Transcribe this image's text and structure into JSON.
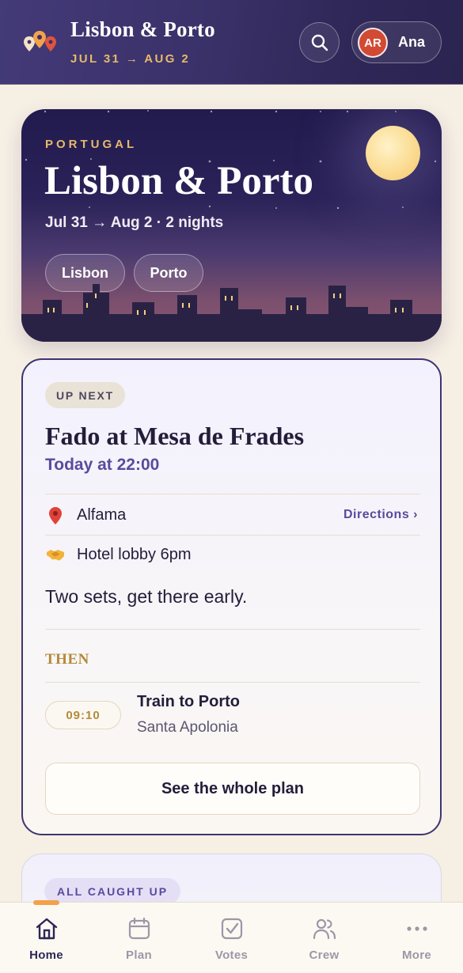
{
  "header": {
    "title": "Lisbon & Porto",
    "dates": "JUL 31 → AUG 2",
    "profile": {
      "initials": "AR",
      "name": "Ana"
    }
  },
  "hero": {
    "eyebrow": "PORTUGAL",
    "title": "Lisbon & Porto",
    "subtitle": "Jul 31 → Aug 2 · 2 nights",
    "cities": [
      "Lisbon",
      "Porto"
    ]
  },
  "up_next": {
    "badge": "UP NEXT",
    "title": "Fado at Mesa de Frades",
    "time": "Today at 22:00",
    "location": "Alfama",
    "directions": "Directions ›",
    "meetup": "Hotel lobby 6pm",
    "note": "Two sets, get there early.",
    "then_label": "THEN",
    "then_item": {
      "time": "09:10",
      "title": "Train to Porto",
      "subtitle": "Santa Apolonia"
    },
    "button": "See the whole plan"
  },
  "status_card": {
    "badge": "ALL CAUGHT UP"
  },
  "nav": {
    "items": [
      {
        "label": "Home",
        "icon": "home-icon"
      },
      {
        "label": "Plan",
        "icon": "calendar-icon"
      },
      {
        "label": "Votes",
        "icon": "checkbox-icon"
      },
      {
        "label": "Crew",
        "icon": "people-icon"
      },
      {
        "label": "More",
        "icon": "more-icon"
      }
    ],
    "active": "Home"
  },
  "colors": {
    "accent_purple": "#5a4a9c",
    "gold": "#e7b96a",
    "header_bg": "#3a3169",
    "page_bg": "#f6efe4"
  }
}
